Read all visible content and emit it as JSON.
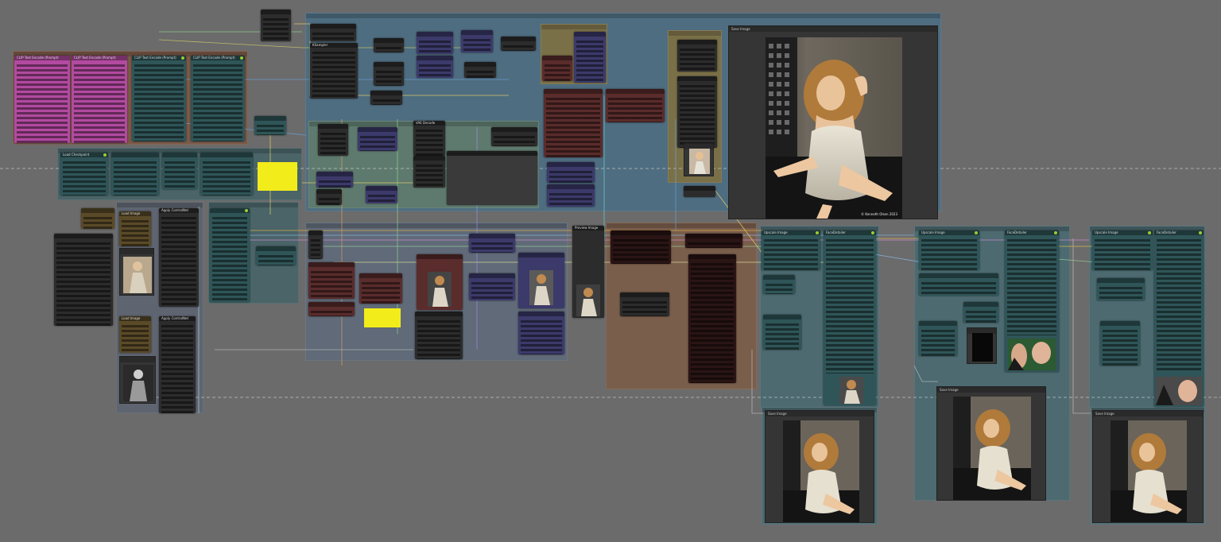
{
  "app": "ComfyUI",
  "main_preview": {
    "title": "Save Image",
    "watermark": "© Kenneth Olsen 2023"
  },
  "node_titles": {
    "load_image": "Load Image",
    "checkpoint": "Load Checkpoint",
    "clip_text": "CLIP Text Encode (Prompt)",
    "ksampler": "KSampler",
    "vae_decode": "VAE Decode",
    "controlnet": "Apply ControlNet",
    "upscale": "Upscale Image",
    "preview": "Preview Image",
    "note": "Note",
    "face_detailer": "FaceDetailer",
    "save_image": "Save Image"
  },
  "colors": {
    "canvas": "#6b6b6b",
    "group_blue": "#4a6a7e",
    "group_teal": "#4a6a70",
    "group_brown": "#7a5a48",
    "group_olive": "#6e6a44",
    "note_yellow": "#f2ec1a",
    "node_teal": "#2f5558",
    "node_purple": "#3c3a6a",
    "node_maroon": "#5a2c2c",
    "node_pink": "#b24aa0"
  },
  "icons": {
    "portrait": "portrait-image",
    "node_status": "status-dot"
  }
}
